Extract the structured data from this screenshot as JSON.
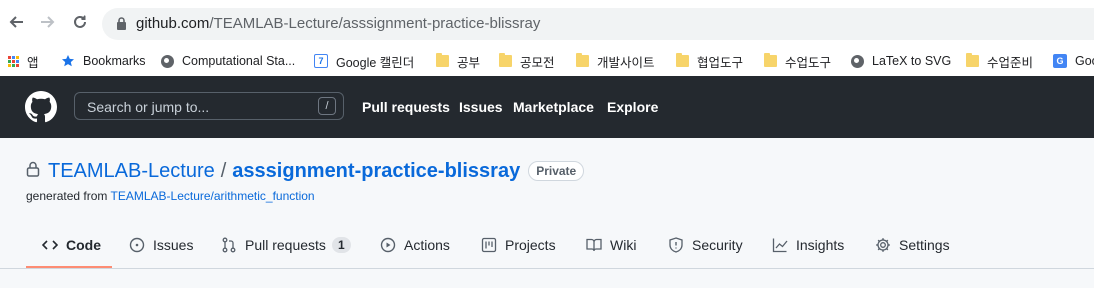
{
  "browser": {
    "url_host": "github.com",
    "url_path": "/TEAMLAB-Lecture/asssignment-practice-blissray",
    "bookmarks": [
      {
        "label": "앱",
        "icon": "apps-grid-icon"
      },
      {
        "label": "Bookmarks",
        "icon": "star-icon"
      },
      {
        "label": "Computational Sta...",
        "icon": "globe-icon"
      },
      {
        "label": "Google 캘린더",
        "icon": "calendar-icon"
      },
      {
        "label": "공부",
        "icon": "folder-icon"
      },
      {
        "label": "공모전",
        "icon": "folder-icon"
      },
      {
        "label": "개발사이트",
        "icon": "folder-icon"
      },
      {
        "label": "협업도구",
        "icon": "folder-icon"
      },
      {
        "label": "수업도구",
        "icon": "folder-icon"
      },
      {
        "label": "LaTeX to SVG",
        "icon": "globe-icon"
      },
      {
        "label": "수업준비",
        "icon": "folder-icon"
      },
      {
        "label": "Goo",
        "icon": "google-translate-icon"
      }
    ]
  },
  "github": {
    "search_placeholder": "Search or jump to...",
    "search_shortcut": "/",
    "nav": [
      "Pull requests",
      "Issues",
      "Marketplace",
      "Explore"
    ]
  },
  "repo": {
    "owner": "TEAMLAB-Lecture",
    "separator": "/",
    "name": "asssignment-practice-blissray",
    "visibility": "Private",
    "generated_prefix": "generated from",
    "generated_link": "TEAMLAB-Lecture/arithmetic_function",
    "tabs": [
      {
        "label": "Code",
        "icon": "code-icon"
      },
      {
        "label": "Issues",
        "icon": "issue-icon"
      },
      {
        "label": "Pull requests",
        "icon": "pull-request-icon",
        "count": "1"
      },
      {
        "label": "Actions",
        "icon": "play-icon"
      },
      {
        "label": "Projects",
        "icon": "project-icon"
      },
      {
        "label": "Wiki",
        "icon": "book-icon"
      },
      {
        "label": "Security",
        "icon": "shield-icon"
      },
      {
        "label": "Insights",
        "icon": "graph-icon"
      },
      {
        "label": "Settings",
        "icon": "gear-icon"
      }
    ]
  },
  "colors": {
    "header_bg": "#24292f",
    "link_blue": "#0969da",
    "tab_active_underline": "#fd8c73"
  }
}
